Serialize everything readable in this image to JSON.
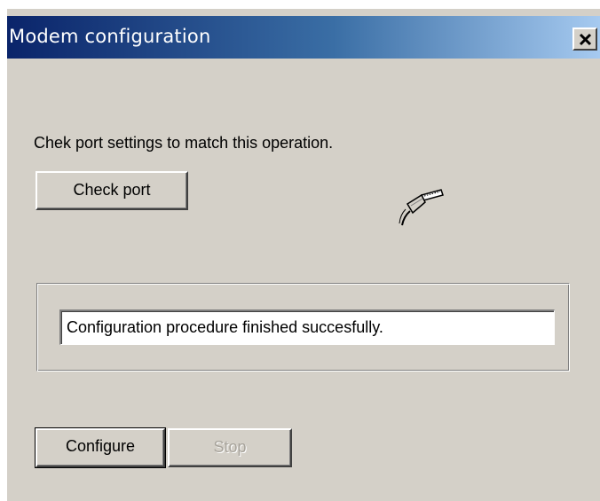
{
  "window": {
    "title": "Modem configuration",
    "close_label": "×"
  },
  "port": {
    "prompt": "Chek port settings to match this operation.",
    "check_button_label": "Check port",
    "icon": "serial-cable-icon"
  },
  "status": {
    "message": "Configuration procedure finished succesfully."
  },
  "actions": {
    "configure_label": "Configure",
    "stop_label": "Stop",
    "stop_enabled": false
  },
  "colors": {
    "face": "#d4d0c8",
    "title_start": "#0a246a",
    "title_end": "#a6caf0",
    "disabled_text": "#a8a49c"
  }
}
